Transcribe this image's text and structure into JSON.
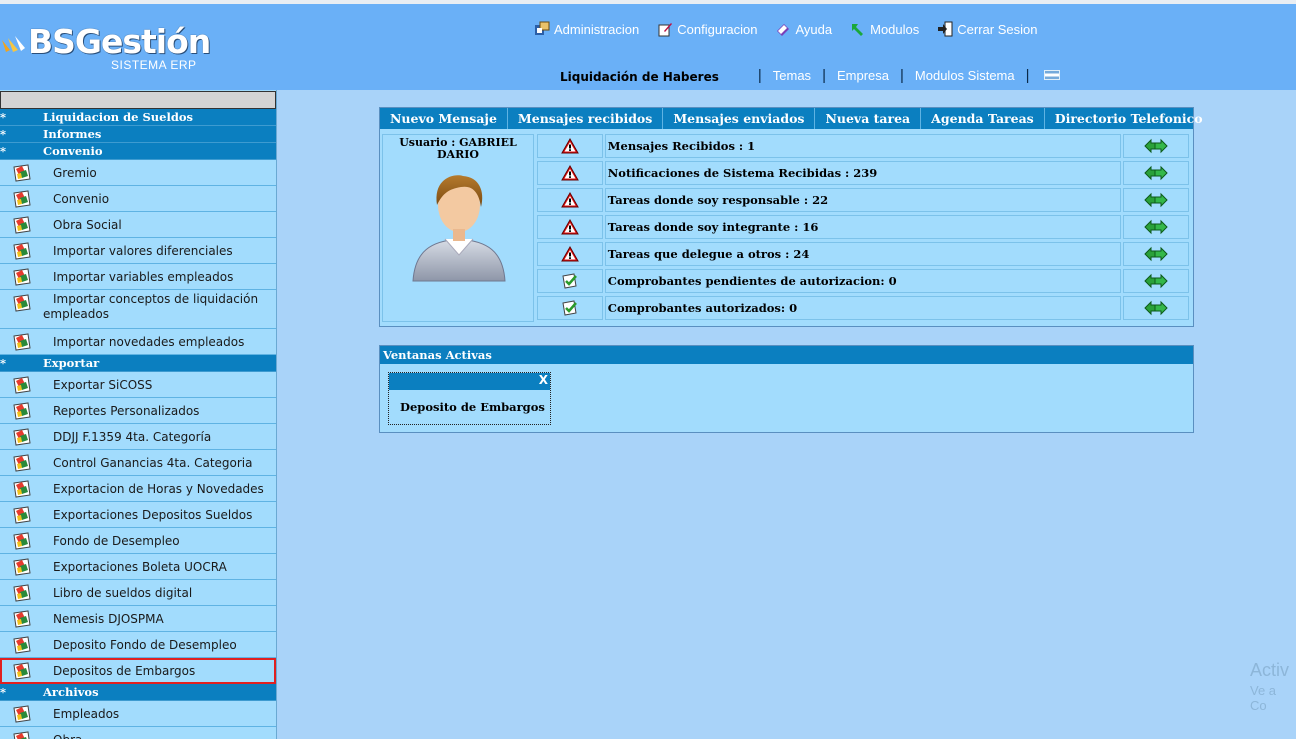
{
  "brand": {
    "name": "BSGestión",
    "tagline": "SISTEMA ERP"
  },
  "topnav": [
    {
      "label": "Administracion",
      "icon": "admin-icon"
    },
    {
      "label": "Configuracion",
      "icon": "config-icon"
    },
    {
      "label": "Ayuda",
      "icon": "help-icon"
    },
    {
      "label": "Modulos",
      "icon": "modules-icon"
    },
    {
      "label": "Cerrar Sesion",
      "icon": "logout-icon"
    }
  ],
  "subnav": {
    "module": "Liquidación de Haberes",
    "links": [
      "Temas",
      "Empresa",
      "Modulos Sistema"
    ],
    "separator": "|"
  },
  "sidebar": {
    "sections": [
      {
        "star": "*",
        "label": "Liquidacion de Sueldos"
      },
      {
        "star": "*",
        "label": "Informes"
      },
      {
        "star": "*",
        "label": "Convenio"
      },
      {
        "star": "*",
        "label": "Exportar"
      },
      {
        "star": "*",
        "label": "Archivos"
      }
    ],
    "convenio_items": [
      "Gremio",
      "Convenio",
      "Obra Social",
      "Importar valores diferenciales",
      "Importar variables empleados",
      "Importar conceptos de liquidación empleados",
      "Importar novedades empleados"
    ],
    "exportar_items": [
      "Exportar SiCOSS",
      "Reportes Personalizados",
      "DDJJ F.1359 4ta. Categoría",
      "Control Ganancias 4ta. Categoria",
      "Exportacion de Horas y Novedades",
      "Exportaciones Depositos Sueldos",
      "Fondo de Desempleo",
      "Exportaciones Boleta UOCRA",
      "Libro de sueldos digital",
      "Nemesis DJOSPMA",
      "Deposito Fondo de Desempleo",
      "Depositos de Embargos"
    ],
    "archivos_items": [
      "Empleados",
      "Obra"
    ]
  },
  "tabs": [
    "Nuevo Mensaje",
    "Mensajes recibidos",
    "Mensajes enviados",
    "Nueva tarea",
    "Agenda Tareas",
    "Directorio Telefonico"
  ],
  "user": {
    "label": "Usuario : GABRIEL DARIO"
  },
  "notifications": [
    {
      "text": "Mensajes Recibidos : 1",
      "status": "warning"
    },
    {
      "text": "Notificaciones de Sistema Recibidas : 239",
      "status": "warning"
    },
    {
      "text": "Tareas donde soy responsable : 22",
      "status": "warning"
    },
    {
      "text": "Tareas donde soy integrante : 16",
      "status": "warning"
    },
    {
      "text": "Tareas que delegue a otros : 24",
      "status": "warning"
    },
    {
      "text": "Comprobantes pendientes de autorizacion: 0",
      "status": "ok"
    },
    {
      "text": "Comprobantes autorizados: 0",
      "status": "ok"
    }
  ],
  "active_windows": {
    "title": "Ventanas Activas",
    "close": "X",
    "items": [
      "Deposito de Embargos"
    ]
  },
  "watermark": {
    "line1": "Activ",
    "line2": "Ve a Co"
  },
  "colors": {
    "header": "#6ab0f7",
    "section": "#0b7fc0",
    "panel": "#a2dcfd",
    "selected_outline": "#e02020"
  }
}
